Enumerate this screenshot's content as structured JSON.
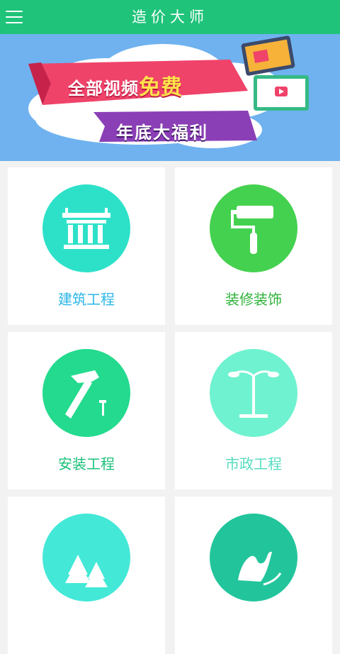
{
  "app": {
    "title": "造价大师"
  },
  "banner": {
    "line1_prefix": "全部视频",
    "line1_highlight": "免费",
    "line2": "年底大福利",
    "slide_count": 4,
    "active_slide": 1
  },
  "categories": [
    {
      "label": "建筑工程",
      "icon": "bridge-icon",
      "color": "#2de1c9",
      "label_color": "#2bb6e6"
    },
    {
      "label": "装修装饰",
      "icon": "paint-roller-icon",
      "color": "#44d14f",
      "label_color": "#2fb23a"
    },
    {
      "label": "安装工程",
      "icon": "hammer-icon",
      "color": "#23da8e",
      "label_color": "#1cc07a"
    },
    {
      "label": "市政工程",
      "icon": "street-lamp-icon",
      "color": "#6ff2cf",
      "label_color": "#56dcc0"
    },
    {
      "label": "",
      "icon": "trees-icon",
      "color": "#43e8d7",
      "label_color": "#43e8d7"
    },
    {
      "label": "",
      "icon": "mountain-icon",
      "color": "#22c59b",
      "label_color": "#22c59b"
    }
  ]
}
